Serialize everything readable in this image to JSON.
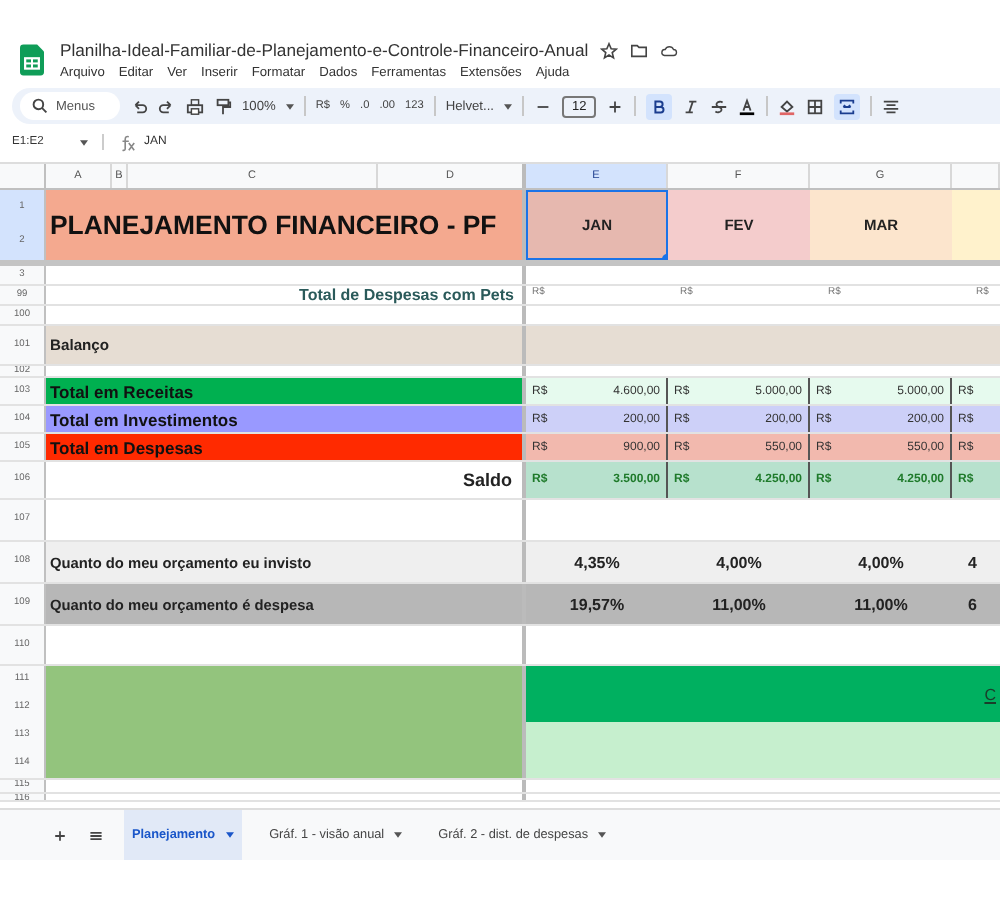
{
  "document": {
    "title": "Planilha-Ideal-Familiar-de-Planejamento-e-Controle-Financeiro-Anual"
  },
  "menu": [
    "Arquivo",
    "Editar",
    "Ver",
    "Inserir",
    "Formatar",
    "Dados",
    "Ferramentas",
    "Extensões",
    "Ajuda"
  ],
  "toolbar": {
    "search_placeholder": "Menus",
    "zoom": "100%",
    "currency": "R$",
    "percent": "%",
    "decrease_decimals": ".0",
    "increase_decimals": ".00",
    "number_format": "123",
    "font": "Helvet...",
    "font_size": "12",
    "bold_selected": true
  },
  "formula_bar": {
    "cell_range": "E1:E2",
    "formula": "JAN"
  },
  "columns": [
    {
      "label": "A",
      "selected": false
    },
    {
      "label": "B",
      "selected": false
    },
    {
      "label": "C",
      "selected": false
    },
    {
      "label": "D",
      "selected": false
    },
    {
      "label": "E",
      "selected": true
    },
    {
      "label": "F",
      "selected": false
    },
    {
      "label": "G",
      "selected": false
    }
  ],
  "rows": [
    {
      "kind": "header",
      "numbers": [
        "1",
        "2"
      ],
      "selected": true,
      "title": "PLANEJAMENTO FINANCEIRO - PF",
      "months": [
        {
          "label": "JAN",
          "color": "#e6b8af",
          "selected": true
        },
        {
          "label": "FEV",
          "color": "#f4cccc",
          "selected": false
        },
        {
          "label": "MAR",
          "color": "#fce5cd",
          "selected": false
        },
        {
          "color": "#fff2cc",
          "selected": false
        }
      ]
    },
    {
      "kind": "blank",
      "numbers": [
        "3"
      ]
    },
    {
      "kind": "subtotal",
      "numbers": [
        "99"
      ],
      "label": "Total de Despesas com Pets",
      "cells": [
        "R$",
        "R$",
        "R$",
        "R$"
      ]
    },
    {
      "kind": "blank",
      "numbers": [
        "100"
      ]
    },
    {
      "kind": "section",
      "numbers": [
        "101"
      ],
      "label": "Balanço"
    },
    {
      "kind": "blank",
      "numbers": [
        "102"
      ]
    },
    {
      "kind": "total",
      "numbers": [
        "103"
      ],
      "label": "Total em Receitas",
      "color": "#00b050",
      "cells": [
        {
          "currency": "R$",
          "amount": "4.600,00"
        },
        {
          "currency": "R$",
          "amount": "5.000,00"
        },
        {
          "currency": "R$",
          "amount": "5.000,00"
        },
        {
          "currency": "R$"
        }
      ]
    },
    {
      "kind": "total",
      "numbers": [
        "104"
      ],
      "label": "Total em Investimentos",
      "color": "#9999ff",
      "cells": [
        {
          "currency": "R$",
          "amount": "200,00"
        },
        {
          "currency": "R$",
          "amount": "200,00"
        },
        {
          "currency": "R$",
          "amount": "200,00"
        },
        {
          "currency": "R$"
        }
      ]
    },
    {
      "kind": "total",
      "numbers": [
        "105"
      ],
      "label": "Total em Despesas",
      "color": "#ff2a00",
      "cells": [
        {
          "currency": "R$",
          "amount": "900,00"
        },
        {
          "currency": "R$",
          "amount": "550,00"
        },
        {
          "currency": "R$",
          "amount": "550,00"
        },
        {
          "currency": "R$"
        }
      ]
    },
    {
      "kind": "saldo",
      "numbers": [
        "106"
      ],
      "label": "Saldo",
      "cells": [
        {
          "currency": "R$",
          "amount": "3.500,00"
        },
        {
          "currency": "R$",
          "amount": "4.250,00"
        },
        {
          "currency": "R$",
          "amount": "4.250,00"
        },
        {
          "currency": "R$"
        }
      ]
    },
    {
      "kind": "blank",
      "numbers": [
        "107"
      ]
    },
    {
      "kind": "percent",
      "numbers": [
        "108"
      ],
      "label": "Quanto do meu orçamento eu invisto",
      "values": [
        "4,35%",
        "4,00%",
        "4,00%",
        "4"
      ]
    },
    {
      "kind": "percent",
      "numbers": [
        "109"
      ],
      "label": "Quanto do meu orçamento é despesa",
      "values": [
        "19,57%",
        "11,00%",
        "11,00%",
        "6"
      ]
    },
    {
      "kind": "blank",
      "numbers": [
        "110"
      ]
    },
    {
      "kind": "banner",
      "numbers": [
        "111",
        "112",
        "113",
        "114"
      ],
      "link": "C"
    },
    {
      "kind": "blank",
      "numbers": [
        "115"
      ]
    },
    {
      "kind": "blank",
      "numbers": [
        "116"
      ]
    }
  ],
  "sheet_tabs": [
    {
      "label": "Planejamento",
      "selected": true
    },
    {
      "label": "Gráf. 1 - visão anual",
      "selected": false
    },
    {
      "label": "Gráf. 2 - dist. de despesas",
      "selected": false
    }
  ]
}
